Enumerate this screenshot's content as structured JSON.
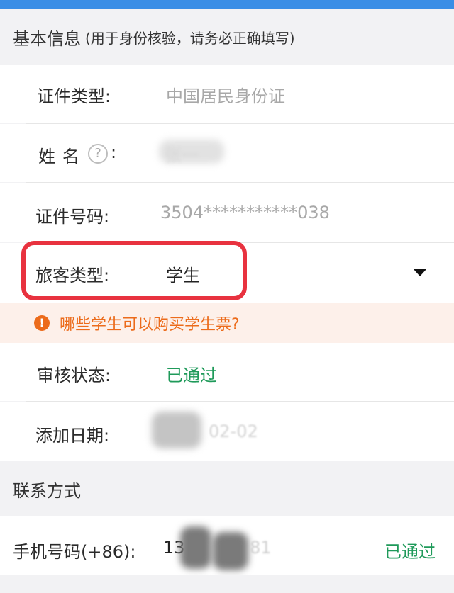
{
  "basic_info": {
    "title": "基本信息",
    "subtitle": "(用于身份核验，请务必正确填写)"
  },
  "fields": {
    "id_type": {
      "label": "证件类型:",
      "value": "中国居民身份证"
    },
    "name": {
      "label_chars": [
        "姓",
        "名"
      ],
      "help_icon_glyph": "?",
      "colon": ":",
      "value": "张一"
    },
    "id_number": {
      "label": "证件号码:",
      "value": "3504***********038"
    },
    "passenger_type": {
      "label": "旅客类型:",
      "value": "学生"
    },
    "review_status": {
      "label": "审核状态:",
      "value": "已通过"
    },
    "add_date": {
      "label": "添加日期:",
      "value_tail": "02-02"
    }
  },
  "notice": {
    "icon_glyph": "!",
    "text": "哪些学生可以购买学生票?"
  },
  "contact": {
    "title": "联系方式",
    "phone_label": "手机号码(+86):",
    "phone_prefix": "13",
    "phone_tail": "81",
    "phone_status": "已通过"
  },
  "icons": {
    "help": "question-circle-icon",
    "dropdown": "caret-down-icon",
    "warning": "warning-circle-icon"
  },
  "colors": {
    "accent_green": "#1f9a5a",
    "warning_orange": "#ec6b1b",
    "highlight_red": "#e8323f",
    "top_bar_blue": "#3a8ee6"
  }
}
